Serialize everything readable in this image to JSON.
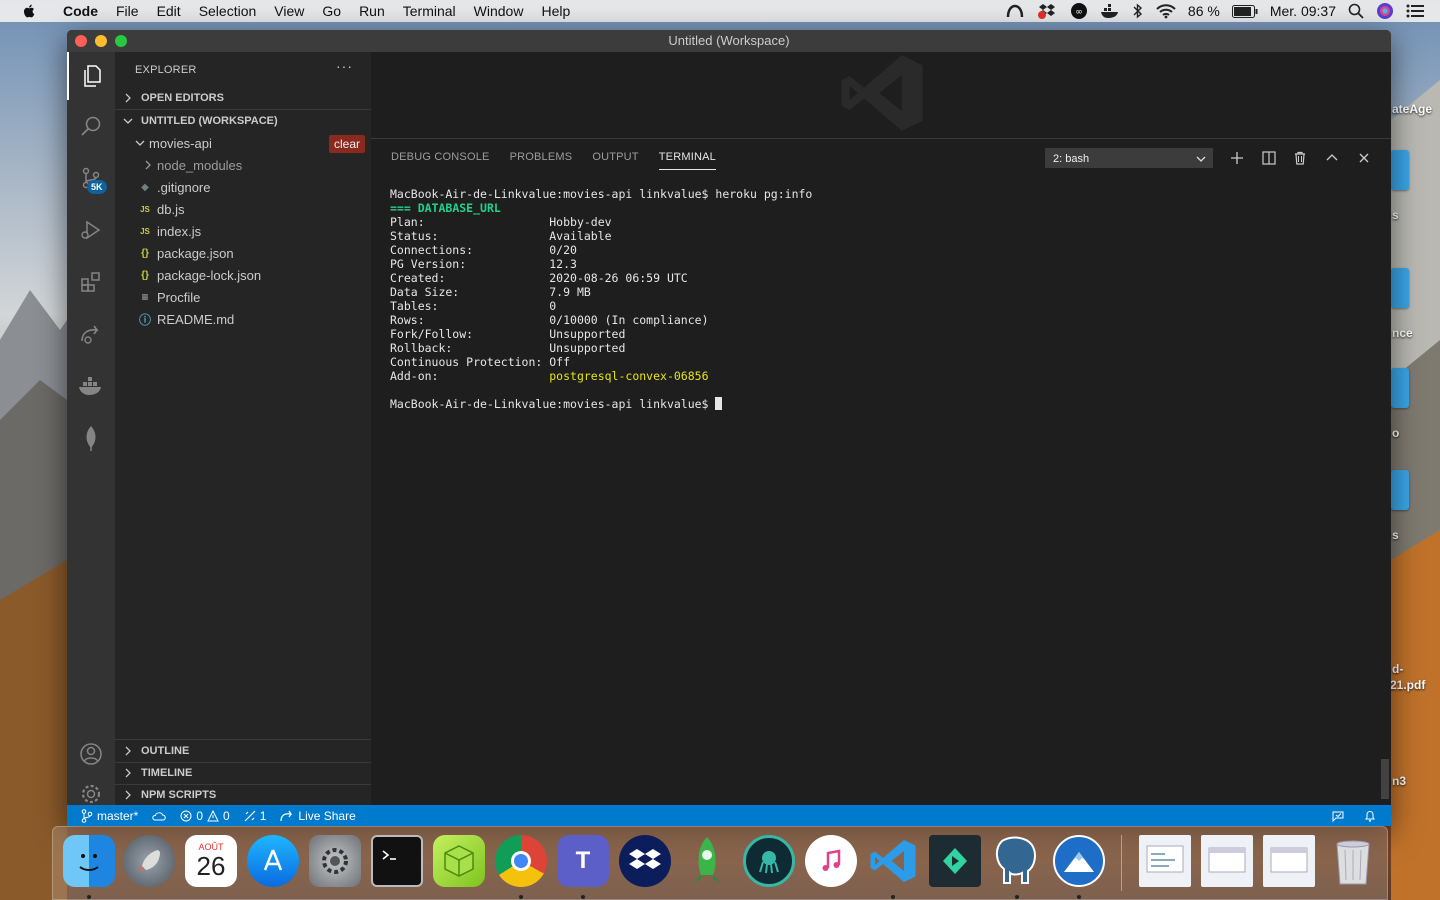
{
  "menubar": {
    "app_name": "Code",
    "items": [
      "File",
      "Edit",
      "Selection",
      "View",
      "Go",
      "Run",
      "Terminal",
      "Window",
      "Help"
    ],
    "battery": "86 %",
    "clock": "Mer. 09:37"
  },
  "desktop_labels": [
    "ateAge",
    "s",
    "nce",
    "o",
    "s",
    "d-",
    "21.pdf",
    "n3"
  ],
  "window": {
    "title": "Untitled (Workspace)"
  },
  "activitybar": {
    "scm_badge": "5K"
  },
  "sidebar": {
    "title": "EXPLORER",
    "more": "···",
    "open_editors": "OPEN EDITORS",
    "workspace": "UNTITLED (WORKSPACE)",
    "folder": "movies-api",
    "clear_label": "clear",
    "files": [
      {
        "name": "node_modules",
        "icon": ">"
      },
      {
        "name": ".gitignore",
        "icon": "◆"
      },
      {
        "name": "db.js",
        "icon": "JS"
      },
      {
        "name": "index.js",
        "icon": "JS"
      },
      {
        "name": "package.json",
        "icon": "{}"
      },
      {
        "name": "package-lock.json",
        "icon": "{}"
      },
      {
        "name": "Procfile",
        "icon": "≡"
      },
      {
        "name": "README.md",
        "icon": "ⓘ"
      }
    ],
    "outline": "OUTLINE",
    "timeline": "TIMELINE",
    "npm_scripts": "NPM SCRIPTS"
  },
  "panel": {
    "tabs": [
      "DEBUG CONSOLE",
      "PROBLEMS",
      "OUTPUT",
      "TERMINAL"
    ],
    "terminal_select": "2: bash"
  },
  "terminal": {
    "prompt1": "MacBook-Air-de-Linkvalue:movies-api linkvalue$ heroku pg:info",
    "header_prefix": "=== ",
    "header": "DATABASE_URL",
    "rows": [
      {
        "k": "Plan:                  ",
        "v": "Hobby-dev"
      },
      {
        "k": "Status:                ",
        "v": "Available"
      },
      {
        "k": "Connections:           ",
        "v": "0/20"
      },
      {
        "k": "PG Version:            ",
        "v": "12.3"
      },
      {
        "k": "Created:               ",
        "v": "2020-08-26 06:59 UTC"
      },
      {
        "k": "Data Size:             ",
        "v": "7.9 MB"
      },
      {
        "k": "Tables:                ",
        "v": "0"
      },
      {
        "k": "Rows:                  ",
        "v": "0/10000 (In compliance)"
      },
      {
        "k": "Fork/Follow:           ",
        "v": "Unsupported"
      },
      {
        "k": "Rollback:              ",
        "v": "Unsupported"
      },
      {
        "k": "Continuous Protection: ",
        "v": "Off"
      }
    ],
    "addon_key": "Add-on:                ",
    "addon_value": "postgresql-convex-06856",
    "prompt2": "MacBook-Air-de-Linkvalue:movies-api linkvalue$ "
  },
  "statusbar": {
    "branch": "master*",
    "errors": "0",
    "warnings": "0",
    "ports": "1",
    "live_share": "Live Share"
  },
  "dock": {
    "calendar_month": "AOÛT",
    "calendar_day": "26"
  }
}
